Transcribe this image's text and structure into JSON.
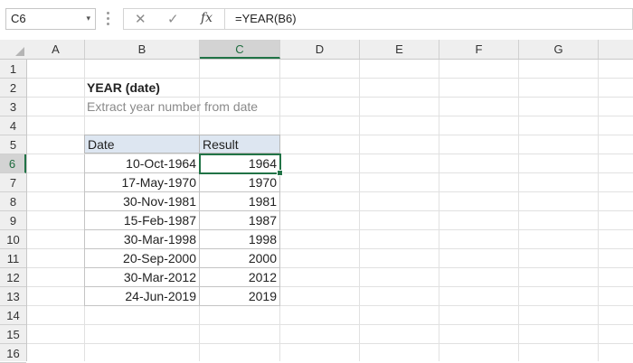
{
  "formula_bar": {
    "name_box": "C6",
    "name_box_arrow": "▾",
    "cancel_icon": "✕",
    "enter_icon": "✓",
    "fx_label": "fx",
    "formula": "=YEAR(B6)"
  },
  "columns": [
    "A",
    "B",
    "C",
    "D",
    "E",
    "F",
    "G"
  ],
  "active_column": "C",
  "rows": [
    "1",
    "2",
    "3",
    "4",
    "5",
    "6",
    "7",
    "8",
    "9",
    "10",
    "11",
    "12",
    "13",
    "14",
    "15",
    "16"
  ],
  "active_row": "6",
  "sheet": {
    "title": "YEAR (date)",
    "subtitle": "Extract year number from date",
    "table": {
      "headers": [
        "Date",
        "Result"
      ],
      "rows": [
        {
          "date": "10-Oct-1964",
          "result": "1964"
        },
        {
          "date": "17-May-1970",
          "result": "1970"
        },
        {
          "date": "30-Nov-1981",
          "result": "1981"
        },
        {
          "date": "15-Feb-1987",
          "result": "1987"
        },
        {
          "date": "30-Mar-1998",
          "result": "1998"
        },
        {
          "date": "20-Sep-2000",
          "result": "2000"
        },
        {
          "date": "30-Mar-2012",
          "result": "2012"
        },
        {
          "date": "24-Jun-2019",
          "result": "2019"
        }
      ]
    }
  },
  "colors": {
    "selection": "#217346",
    "table_header_fill": "#dde6f1"
  }
}
